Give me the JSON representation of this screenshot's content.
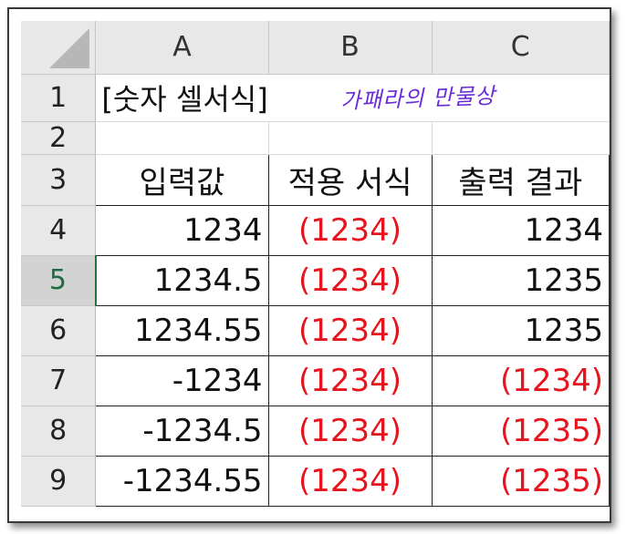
{
  "columns": [
    "A",
    "B",
    "C"
  ],
  "rows": [
    {
      "num": "1",
      "a": "[숫자 셀서식]",
      "b": "",
      "c": ""
    },
    {
      "num": "2",
      "a": "",
      "b": "",
      "c": ""
    },
    {
      "num": "3",
      "a": "입력값",
      "b": "적용 서식",
      "c": "출력 결과"
    },
    {
      "num": "4",
      "a": "1234",
      "b": "(1234)",
      "c": "1234"
    },
    {
      "num": "5",
      "a": "1234.5",
      "b": "(1234)",
      "c": "1235"
    },
    {
      "num": "6",
      "a": "1234.55",
      "b": "(1234)",
      "c": "1235"
    },
    {
      "num": "7",
      "a": "-1234",
      "b": "(1234)",
      "c": "(1234)"
    },
    {
      "num": "8",
      "a": "-1234.5",
      "b": "(1234)",
      "c": "(1235)"
    },
    {
      "num": "9",
      "a": "-1234.55",
      "b": "(1234)",
      "c": "(1235)"
    }
  ],
  "watermark": "가패라의 만물상",
  "selected_row": "5",
  "colors": {
    "red_text": "#e8141d",
    "watermark": "#6a2bd9",
    "selection": "#217346"
  }
}
